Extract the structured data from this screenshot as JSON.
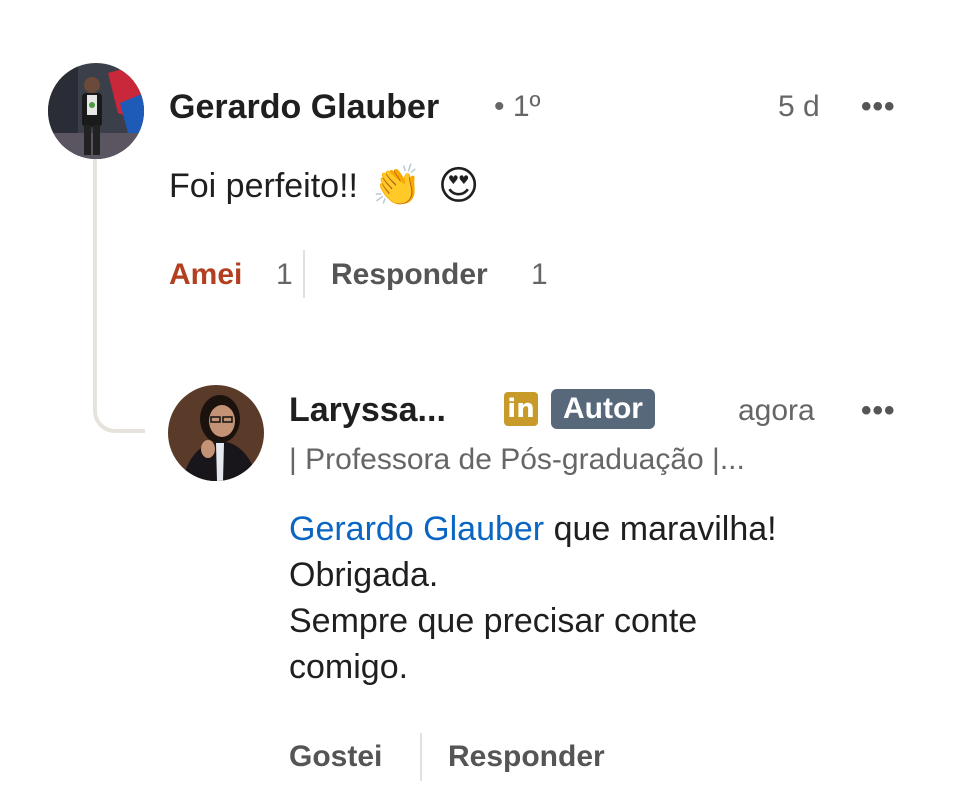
{
  "comment": {
    "author_name": "Gerardo Glauber",
    "degree": "• 1º",
    "time": "5 d",
    "more_label": "•••",
    "text": "Foi perfeito!!",
    "emojis": [
      "👏",
      "😍"
    ],
    "reaction_label": "Amei",
    "reaction_count": "1",
    "reply_label": "Responder",
    "reply_count": "1"
  },
  "reply": {
    "author_name": "Laryssa...",
    "linkedin_badge": "in",
    "author_badge": "Autor",
    "time": "agora",
    "more_label": "•••",
    "headline": "| Professora de Pós-graduação |...",
    "mention": "Gerardo Glauber",
    "text_line1_rest": " que maravilha!",
    "text_line2": "Obrigada.",
    "text_line3": "Sempre que precisar conte",
    "text_line4": "comigo.",
    "like_label": "Gostei",
    "reply_label": "Responder"
  },
  "colors": {
    "mention": "#0a66c2",
    "reaction": "#b24020",
    "author_badge": "#56687a",
    "linkedin_badge": "#c79a2a"
  }
}
